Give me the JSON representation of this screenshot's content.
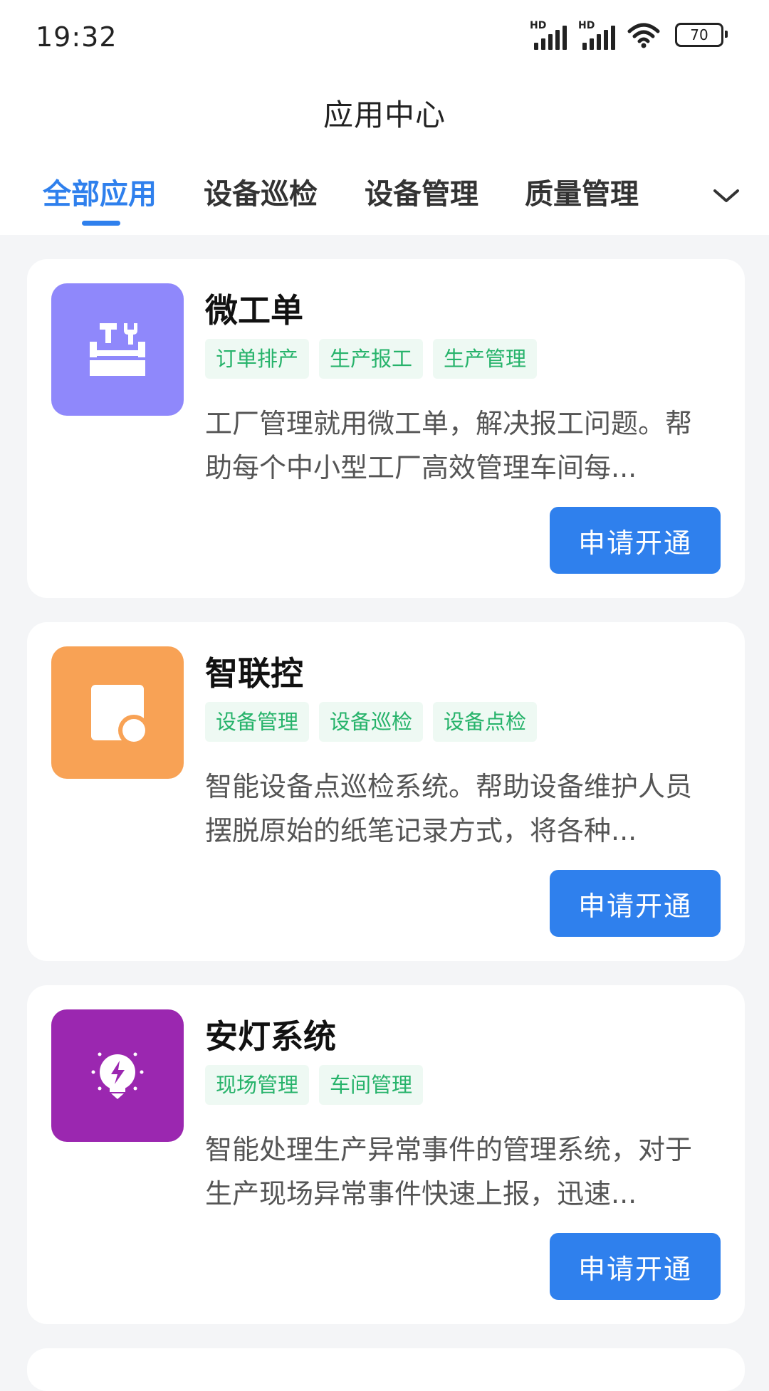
{
  "status_bar": {
    "time": "19:32",
    "signal_label_1": "HD",
    "signal_label_2": "HD",
    "battery": "70"
  },
  "header": {
    "title": "应用中心"
  },
  "tabs": [
    {
      "label": "全部应用",
      "active": true
    },
    {
      "label": "设备巡检"
    },
    {
      "label": "设备管理"
    },
    {
      "label": "质量管理"
    }
  ],
  "apps": [
    {
      "name": "微工单",
      "icon": "toolbox-icon",
      "icon_color": "#8f88fb",
      "tags": [
        "订单排产",
        "生产报工",
        "生产管理"
      ],
      "description": "工厂管理就用微工单，解决报工问题。帮助每个中小型工厂高效管理车间每...",
      "button": "申请开通"
    },
    {
      "name": "智联控",
      "icon": "device-icon",
      "icon_color": "#f8a255",
      "tags": [
        "设备管理",
        "设备巡检",
        "设备点检"
      ],
      "description": "智能设备点巡检系统。帮助设备维护人员摆脱原始的纸笔记录方式，将各种...",
      "button": "申请开通"
    },
    {
      "name": "安灯系统",
      "icon": "lightbulb-icon",
      "icon_color": "#9b27b0",
      "tags": [
        "现场管理",
        "车间管理"
      ],
      "description": "智能处理生产异常事件的管理系统，对于生产现场异常事件快速上报，迅速...",
      "button": "申请开通"
    }
  ],
  "colors": {
    "accent": "#2f80ed",
    "tag_text": "#27b36b",
    "tag_bg": "#eef9f3",
    "page_bg": "#f4f5f7"
  }
}
